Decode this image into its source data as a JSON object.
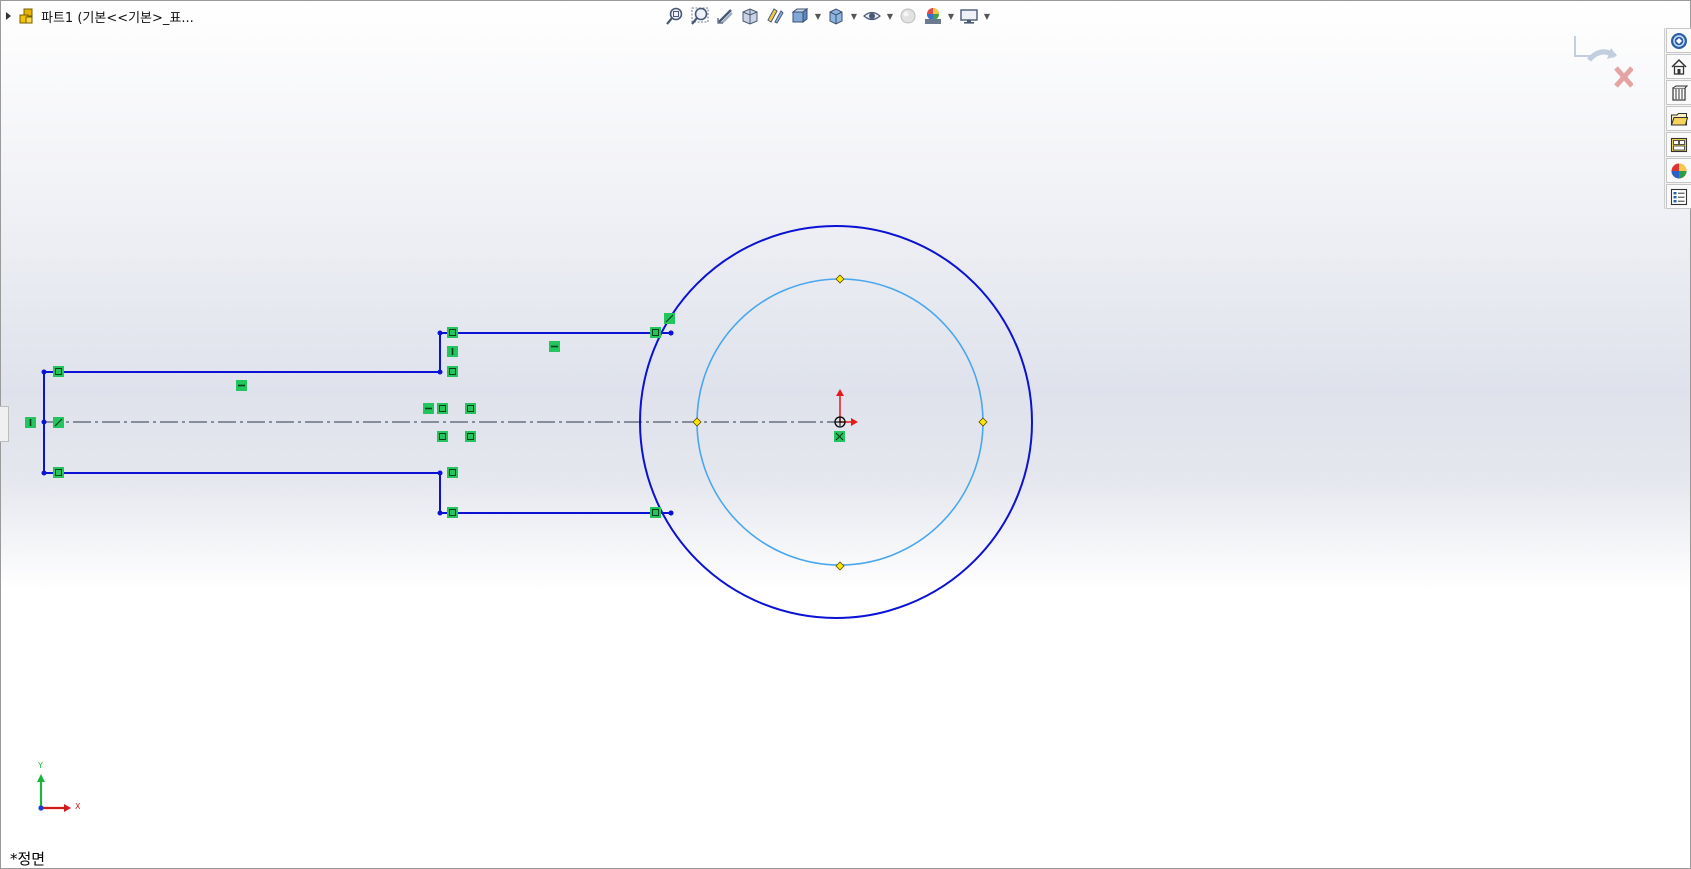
{
  "document": {
    "tree_title": "파트1  (기본<<기본>_표...",
    "view_name": "*정면"
  },
  "toolbar": {
    "icons": [
      "zoom-to-fit-icon",
      "zoom-to-area-icon",
      "previous-view-icon",
      "section-view-icon",
      "dynamic-annotation-views-icon",
      "view-orientation-icon",
      "display-style-icon",
      "hide-show-items-icon",
      "edit-appearance-icon",
      "apply-scene-icon",
      "view-settings-icon"
    ]
  },
  "task_pane": {
    "icons": [
      "solidworks-resources-icon",
      "home-icon",
      "design-library-icon",
      "file-explorer-icon",
      "view-palette-icon",
      "appearances-icon",
      "custom-properties-icon"
    ]
  },
  "triad": {
    "x_label": "X",
    "y_label": "Y"
  },
  "colors": {
    "sketch_line": "#0b12d4",
    "construction_circle": "#4aa6ee",
    "relation_badge": "#22c55e",
    "origin_x": "#e31b1b",
    "origin_y": "#e31b1b",
    "confirm_x": "#e05a5a"
  }
}
